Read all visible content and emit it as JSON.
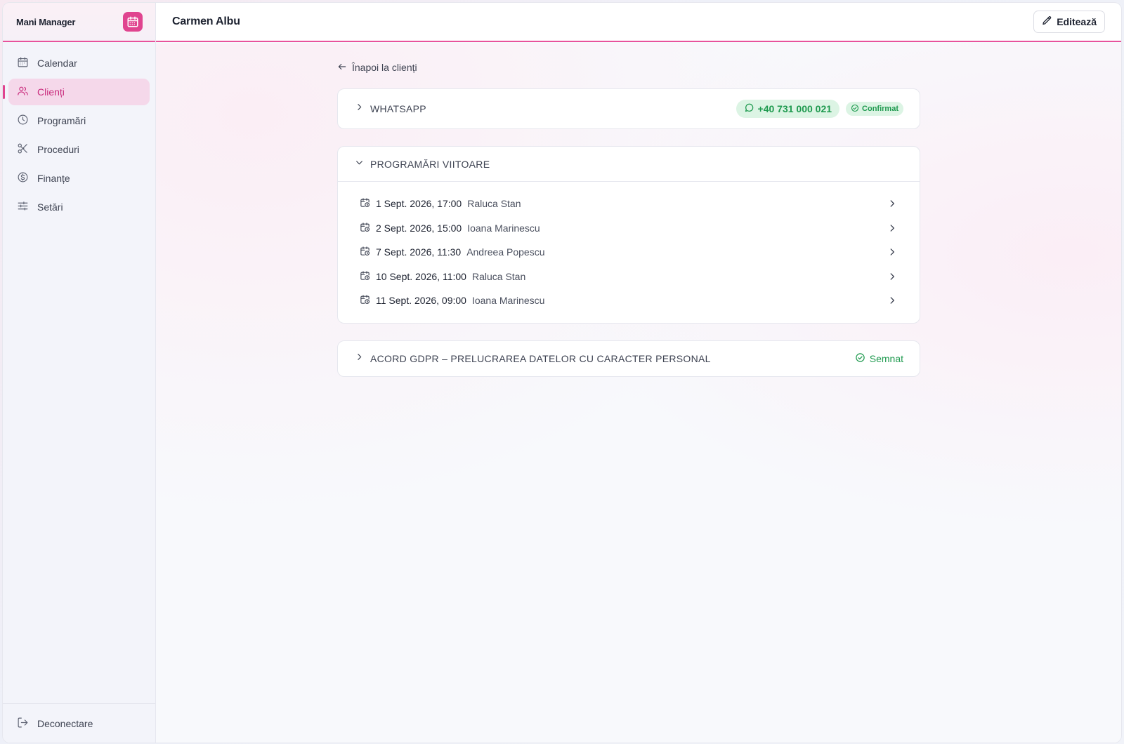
{
  "app": {
    "name": "Mani Manager",
    "logo_icon": "calendar-icon",
    "accent": "#e0448f"
  },
  "sidebar": {
    "items": [
      {
        "label": "Calendar",
        "icon": "calendar-icon",
        "active": false
      },
      {
        "label": "Clienți",
        "icon": "users-icon",
        "active": true
      },
      {
        "label": "Programări",
        "icon": "clock-icon",
        "active": false
      },
      {
        "label": "Proceduri",
        "icon": "scissors-icon",
        "active": false
      },
      {
        "label": "Finanțe",
        "icon": "dollar-icon",
        "active": false
      },
      {
        "label": "Setări",
        "icon": "sliders-icon",
        "active": false
      }
    ],
    "logout_label": "Deconectare"
  },
  "header": {
    "title": "Carmen Albu",
    "edit_label": "Editează"
  },
  "main": {
    "back_label": "Înapoi la clienți",
    "whatsapp": {
      "title": "WHATSAPP",
      "phone": "+40 731 000 021",
      "status": "Confirmat",
      "status_color": "#1f9a4f"
    },
    "appointments": {
      "title": "PROGRAMĂRI VIITOARE",
      "items": [
        {
          "date": "1 Sept. 2026, 17:00",
          "who": "Raluca Stan"
        },
        {
          "date": "2 Sept. 2026, 15:00",
          "who": "Ioana Marinescu"
        },
        {
          "date": "7 Sept. 2026, 11:30",
          "who": "Andreea Popescu"
        },
        {
          "date": "10 Sept. 2026, 11:00",
          "who": "Raluca Stan"
        },
        {
          "date": "11 Sept. 2026, 09:00",
          "who": "Ioana Marinescu"
        }
      ]
    },
    "gdpr": {
      "title": "ACORD GDPR – PRELUCRAREA DATELOR CU CARACTER PERSONAL",
      "status": "Semnat"
    }
  }
}
